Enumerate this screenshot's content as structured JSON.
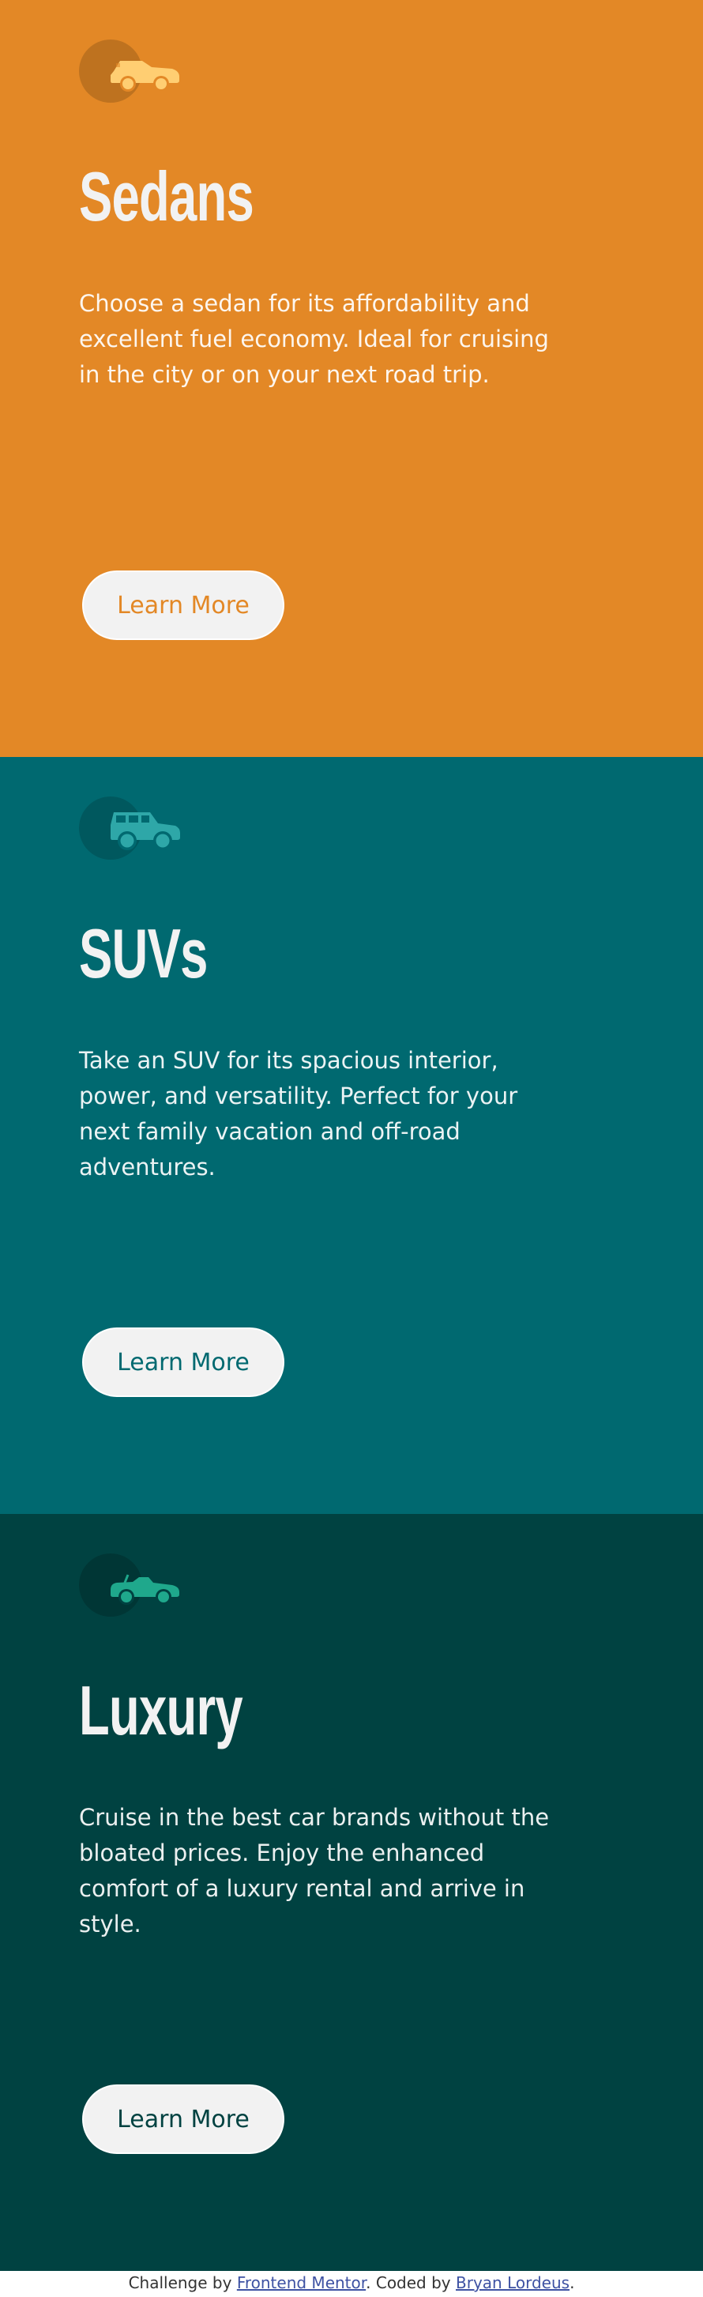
{
  "cards": [
    {
      "id": "sedans",
      "icon": "sedan-car-icon",
      "title": "Sedans",
      "text": "Choose a sedan for its affordability and excellent fuel economy. Ideal for cruising in the city or on your next road trip.",
      "button_label": "Learn More",
      "bg_color": "#e38826",
      "icon_color": "#ffce72"
    },
    {
      "id": "suvs",
      "icon": "suv-car-icon",
      "title": "SUVs",
      "text": "Take an SUV for its spacious interior, power, and versatility. Perfect for your next family vacation and off-road adventures.",
      "button_label": "Learn More",
      "bg_color": "#006970",
      "icon_color": "#2ea7a8"
    },
    {
      "id": "luxury",
      "icon": "luxury-car-icon",
      "title": "Luxury",
      "text": "Cruise in the best car brands without the bloated prices. Enjoy the enhanced comfort of a luxury rental and arrive in style.",
      "button_label": "Learn More",
      "bg_color": "#004241",
      "icon_color": "#1fa88c"
    }
  ],
  "attribution": {
    "prefix": "Challenge by ",
    "link1": "Frontend Mentor",
    "middle": ". Coded by ",
    "link2": "Bryan Lordeus",
    "suffix": "."
  }
}
